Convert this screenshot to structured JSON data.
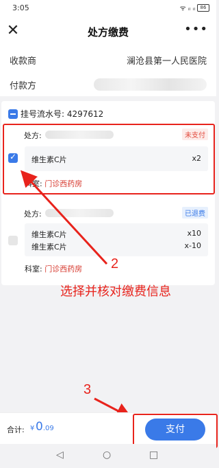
{
  "status_bar": {
    "time": "3:05",
    "signal_icons": "ᯤ ᵢₗ ᵢₗ",
    "battery": "86"
  },
  "nav": {
    "title": "处方缴费",
    "close_icon": "close-icon",
    "more_icon": "more-icon"
  },
  "payee": {
    "label": "收款商",
    "value": "澜沧县第一人民医院"
  },
  "payer": {
    "label": "付款方"
  },
  "order": {
    "serial_label": "挂号流水号: 4297612"
  },
  "prescriptions": [
    {
      "label": "处方:",
      "status": "未支付",
      "checked": true,
      "items": [
        {
          "name": "维生素C片",
          "qty": "x2"
        }
      ],
      "dept_label": "科室:",
      "dept_value": "门诊西药房"
    },
    {
      "label": "处方:",
      "status": "已退费",
      "checked": false,
      "items": [
        {
          "name": "维生素C片",
          "qty": "x10"
        },
        {
          "name": "维生素C片",
          "qty": "x-10"
        }
      ],
      "dept_label": "科室:",
      "dept_value": "门诊西药房"
    }
  ],
  "annotations": {
    "step2_number": "2",
    "step2_text": "选择并核对缴费信息",
    "step3_number": "3"
  },
  "footer": {
    "total_label": "合计:",
    "currency": "¥",
    "amount_int": "0",
    "amount_dec": ".09",
    "pay_label": "支付"
  },
  "system_nav": {
    "back": "◁",
    "home": "○",
    "recent": "□"
  },
  "colors": {
    "accent": "#3a7ae8",
    "annotation": "#e8231c",
    "dept": "#d73a2f"
  }
}
